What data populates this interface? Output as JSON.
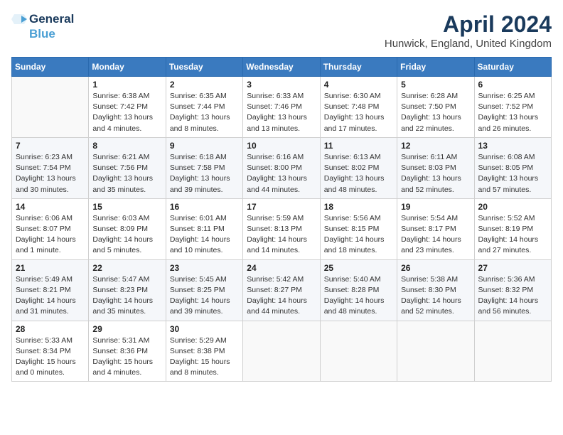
{
  "logo": {
    "line1": "General",
    "line2": "Blue",
    "icon": "▶"
  },
  "title": "April 2024",
  "location": "Hunwick, England, United Kingdom",
  "headers": [
    "Sunday",
    "Monday",
    "Tuesday",
    "Wednesday",
    "Thursday",
    "Friday",
    "Saturday"
  ],
  "weeks": [
    [
      {
        "day": "",
        "info": ""
      },
      {
        "day": "1",
        "info": "Sunrise: 6:38 AM\nSunset: 7:42 PM\nDaylight: 13 hours\nand 4 minutes."
      },
      {
        "day": "2",
        "info": "Sunrise: 6:35 AM\nSunset: 7:44 PM\nDaylight: 13 hours\nand 8 minutes."
      },
      {
        "day": "3",
        "info": "Sunrise: 6:33 AM\nSunset: 7:46 PM\nDaylight: 13 hours\nand 13 minutes."
      },
      {
        "day": "4",
        "info": "Sunrise: 6:30 AM\nSunset: 7:48 PM\nDaylight: 13 hours\nand 17 minutes."
      },
      {
        "day": "5",
        "info": "Sunrise: 6:28 AM\nSunset: 7:50 PM\nDaylight: 13 hours\nand 22 minutes."
      },
      {
        "day": "6",
        "info": "Sunrise: 6:25 AM\nSunset: 7:52 PM\nDaylight: 13 hours\nand 26 minutes."
      }
    ],
    [
      {
        "day": "7",
        "info": "Sunrise: 6:23 AM\nSunset: 7:54 PM\nDaylight: 13 hours\nand 30 minutes."
      },
      {
        "day": "8",
        "info": "Sunrise: 6:21 AM\nSunset: 7:56 PM\nDaylight: 13 hours\nand 35 minutes."
      },
      {
        "day": "9",
        "info": "Sunrise: 6:18 AM\nSunset: 7:58 PM\nDaylight: 13 hours\nand 39 minutes."
      },
      {
        "day": "10",
        "info": "Sunrise: 6:16 AM\nSunset: 8:00 PM\nDaylight: 13 hours\nand 44 minutes."
      },
      {
        "day": "11",
        "info": "Sunrise: 6:13 AM\nSunset: 8:02 PM\nDaylight: 13 hours\nand 48 minutes."
      },
      {
        "day": "12",
        "info": "Sunrise: 6:11 AM\nSunset: 8:03 PM\nDaylight: 13 hours\nand 52 minutes."
      },
      {
        "day": "13",
        "info": "Sunrise: 6:08 AM\nSunset: 8:05 PM\nDaylight: 13 hours\nand 57 minutes."
      }
    ],
    [
      {
        "day": "14",
        "info": "Sunrise: 6:06 AM\nSunset: 8:07 PM\nDaylight: 14 hours\nand 1 minute."
      },
      {
        "day": "15",
        "info": "Sunrise: 6:03 AM\nSunset: 8:09 PM\nDaylight: 14 hours\nand 5 minutes."
      },
      {
        "day": "16",
        "info": "Sunrise: 6:01 AM\nSunset: 8:11 PM\nDaylight: 14 hours\nand 10 minutes."
      },
      {
        "day": "17",
        "info": "Sunrise: 5:59 AM\nSunset: 8:13 PM\nDaylight: 14 hours\nand 14 minutes."
      },
      {
        "day": "18",
        "info": "Sunrise: 5:56 AM\nSunset: 8:15 PM\nDaylight: 14 hours\nand 18 minutes."
      },
      {
        "day": "19",
        "info": "Sunrise: 5:54 AM\nSunset: 8:17 PM\nDaylight: 14 hours\nand 23 minutes."
      },
      {
        "day": "20",
        "info": "Sunrise: 5:52 AM\nSunset: 8:19 PM\nDaylight: 14 hours\nand 27 minutes."
      }
    ],
    [
      {
        "day": "21",
        "info": "Sunrise: 5:49 AM\nSunset: 8:21 PM\nDaylight: 14 hours\nand 31 minutes."
      },
      {
        "day": "22",
        "info": "Sunrise: 5:47 AM\nSunset: 8:23 PM\nDaylight: 14 hours\nand 35 minutes."
      },
      {
        "day": "23",
        "info": "Sunrise: 5:45 AM\nSunset: 8:25 PM\nDaylight: 14 hours\nand 39 minutes."
      },
      {
        "day": "24",
        "info": "Sunrise: 5:42 AM\nSunset: 8:27 PM\nDaylight: 14 hours\nand 44 minutes."
      },
      {
        "day": "25",
        "info": "Sunrise: 5:40 AM\nSunset: 8:28 PM\nDaylight: 14 hours\nand 48 minutes."
      },
      {
        "day": "26",
        "info": "Sunrise: 5:38 AM\nSunset: 8:30 PM\nDaylight: 14 hours\nand 52 minutes."
      },
      {
        "day": "27",
        "info": "Sunrise: 5:36 AM\nSunset: 8:32 PM\nDaylight: 14 hours\nand 56 minutes."
      }
    ],
    [
      {
        "day": "28",
        "info": "Sunrise: 5:33 AM\nSunset: 8:34 PM\nDaylight: 15 hours\nand 0 minutes."
      },
      {
        "day": "29",
        "info": "Sunrise: 5:31 AM\nSunset: 8:36 PM\nDaylight: 15 hours\nand 4 minutes."
      },
      {
        "day": "30",
        "info": "Sunrise: 5:29 AM\nSunset: 8:38 PM\nDaylight: 15 hours\nand 8 minutes."
      },
      {
        "day": "",
        "info": ""
      },
      {
        "day": "",
        "info": ""
      },
      {
        "day": "",
        "info": ""
      },
      {
        "day": "",
        "info": ""
      }
    ]
  ]
}
